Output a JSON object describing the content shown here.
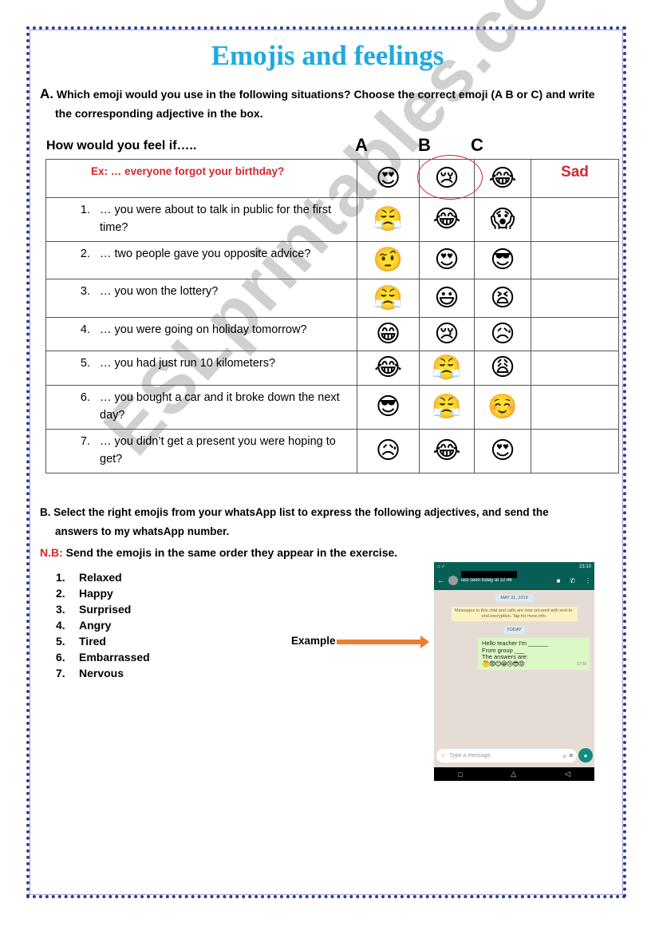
{
  "title": "Emojis and feelings",
  "section_a": {
    "letter": "A.",
    "instruction_line1": "Which emoji would you use in the following situations? Choose the correct emoji (A B or C) and write",
    "instruction_line2": "the corresponding adjective in the box.",
    "prompt": "How would you feel if…..",
    "column_letters": [
      "A",
      "B",
      "C"
    ],
    "example": {
      "label": "Ex:    … everyone forgot your birthday?",
      "emojis": [
        "😍",
        "😢",
        "😂"
      ],
      "emoji_names": [
        "heart-eyes",
        "crying",
        "tears-of-joy"
      ],
      "circled": "B",
      "answer": "Sad"
    },
    "questions": [
      {
        "num": "1.",
        "text": "… you were about to talk in public for the first time?",
        "emojis": [
          "😤",
          "😂",
          "😱"
        ],
        "answer": ""
      },
      {
        "num": "2.",
        "text": "… two people gave you opposite advice?",
        "emojis": [
          "🤨",
          "😍",
          "😎"
        ],
        "answer": ""
      },
      {
        "num": "3.",
        "text": "… you won the lottery?",
        "emojis": [
          "😤",
          "😃",
          "😫"
        ],
        "answer": ""
      },
      {
        "num": "4.",
        "text": "… you were going on holiday tomorrow?",
        "emojis": [
          "😁",
          "😢",
          "😥"
        ],
        "answer": ""
      },
      {
        "num": "5.",
        "text": "… you had just run 10 kilometers?",
        "emojis": [
          "😂",
          "😤",
          "😩"
        ],
        "answer": ""
      },
      {
        "num": "6.",
        "text": "… you bought a car and it broke down the next day?",
        "emojis": [
          "😎",
          "😤",
          "☺️"
        ],
        "answer": ""
      },
      {
        "num": "7.",
        "text": "… you didn’t get a present you were hoping to get?",
        "emojis": [
          "😥",
          "😂",
          "😍"
        ],
        "answer": ""
      }
    ]
  },
  "section_b": {
    "instruction_line1": "B.  Select the right emojis from your whatsApp list to express the following adjectives, and send the",
    "instruction_line2": "answers to my whatsApp number.",
    "nb_label": "N.B:",
    "nb_text": " Send the emojis in the same order they appear in the exercise.",
    "adjectives": [
      {
        "num": "1.",
        "label": "Relaxed"
      },
      {
        "num": "2.",
        "label": "Happy"
      },
      {
        "num": "3.",
        "label": "Surprised"
      },
      {
        "num": "4.",
        "label": "Angry"
      },
      {
        "num": "5.",
        "label": "Tired"
      },
      {
        "num": "6.",
        "label": "Embarrassed"
      },
      {
        "num": "7.",
        "label": "Nervous"
      }
    ],
    "example_label": "Example",
    "arrow_color": "#ed7d31"
  },
  "phone": {
    "status_time": "23:10",
    "last_seen": "last seen today at 22:46",
    "date_chip": "MAY 31, 2019",
    "encryption_notice": "Messages to this chat and calls are now secured with end-to-end encryption. Tap for more info.",
    "today_chip": "TODAY",
    "message_lines": [
      "Hello teacher I'm ______",
      "From group ___",
      "The answers are:"
    ],
    "message_emojis": "🤔😨😊😁😢😎😡",
    "message_time": "22:38",
    "input_placeholder": "Type a message",
    "icons": {
      "back": "←",
      "video": "■",
      "call": "✆",
      "menu": "⋮",
      "emoji": "☺",
      "attach": "⌀",
      "camera": "◙",
      "mic": "🎤",
      "nav_square": "□",
      "nav_home": "△",
      "nav_back": "◁"
    },
    "header_color": "#075e54"
  },
  "colors": {
    "title": "#1eaadf",
    "red": "#d7262e",
    "border": "#2e3a8c"
  },
  "watermark": "ESLprintables.com"
}
